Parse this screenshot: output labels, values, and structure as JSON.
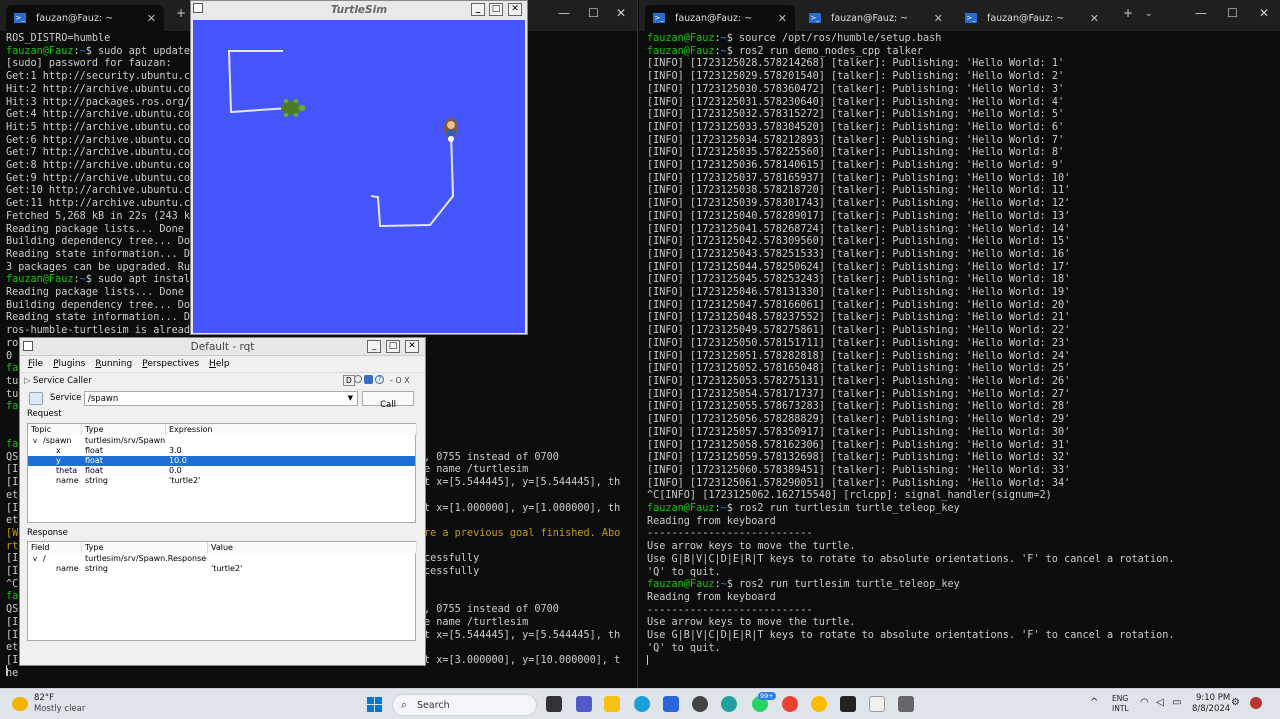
{
  "left_terminal": {
    "tab_label": "fauzan@Fauz: ~",
    "lines_top": [
      {
        "t": "ROS_DISTRO=humble"
      },
      {
        "p": "fauzan@Fauz",
        "c": "~",
        "cmd": "$ sudo apt update"
      },
      {
        "t": "[sudo] password for fauzan:"
      },
      {
        "t": "Get:1 http://security.ubuntu.co"
      },
      {
        "t": "Hit:2 http://archive.ubuntu.com"
      },
      {
        "t": "Hit:3 http://packages.ros.org/r"
      },
      {
        "t": "Get:4 http://archive.ubuntu.com"
      },
      {
        "t": "Hit:5 http://archive.ubuntu.com"
      },
      {
        "t": "Get:6 http://archive.ubuntu.com"
      },
      {
        "t": "Get:7 http://archive.ubuntu.com"
      },
      {
        "t": "Get:8 http://archive.ubuntu.com                                             ]"
      },
      {
        "t": "Get:9 http://archive.ubuntu.com                                             B]"
      },
      {
        "t": "Get:10 http://archive.ubuntu.co                                             ]"
      },
      {
        "t": "Get:11 http://archive.ubuntu.co                                           .9 kB]"
      },
      {
        "t": "Fetched 5,268 kB in 22s (243 k"
      },
      {
        "t": "Reading package lists... Done"
      },
      {
        "t": "Building dependency tree... Don"
      },
      {
        "t": "Reading state information... Do"
      },
      {
        "t": "3 packages can be upgraded. Run"
      },
      {
        "p": "fauzan@Fauz",
        "c": "~",
        "cmd": "$ sudo apt instal"
      },
      {
        "t": "Reading package lists... Done"
      },
      {
        "t": "Building dependency tree... Don"
      },
      {
        "t": "Reading state information... Do"
      },
      {
        "t": "ros-humble-turtlesim is already"
      },
      {
        "t": "ro"
      },
      {
        "t": "0"
      },
      {
        "t": "fa",
        "g": true
      },
      {
        "t": "tu"
      },
      {
        "t": "tu"
      },
      {
        "t": "fa",
        "g": true
      }
    ],
    "lines_bottom": [
      {
        "t": "fa",
        "tail": ""
      },
      {
        "t": "QS",
        "tail": ", 0755 instead of 0700"
      },
      {
        "t": "[I",
        "tail": "e name /turtlesim"
      },
      {
        "t": "[I",
        "tail": "t x=[5.544445], y=[5.544445], th"
      },
      {
        "t": "et",
        "tail": ""
      },
      {
        "t": "[I",
        "tail": "t x=[1.000000], y=[1.000000], th"
      },
      {
        "t": "et",
        "tail": ""
      },
      {
        "t": "[W",
        "tail": "re a previous goal finished. Abo",
        "warn": true
      },
      {
        "t": "rt",
        "tail": "",
        "warn": true
      },
      {
        "t": "[I",
        "tail": "cessfully"
      },
      {
        "t": "[I",
        "tail": "cessfully"
      },
      {
        "t": "^C",
        "tail": ""
      },
      {
        "t": "fa",
        "tail": ""
      },
      {
        "t": "QS",
        "tail": ", 0755 instead of 0700"
      },
      {
        "t": "[I",
        "tail": "e name /turtlesim"
      },
      {
        "t": "[I",
        "tail": "t x=[5.544445], y=[5.544445], th"
      },
      {
        "t": "et",
        "tail": ""
      },
      {
        "t": "[I",
        "tail": "t x=[3.000000], y=[10.000000], t"
      },
      {
        "t": "he",
        "tail": ""
      }
    ]
  },
  "right_terminal": {
    "tabs": [
      "fauzan@Fauz: ~",
      "fauzan@Fauz: ~",
      "fauzan@Fauz: ~"
    ],
    "prompt_user": "fauzan@Fauz",
    "prompt_dir": "~",
    "cmd1": "$ source /opt/ros/humble/setup.bash",
    "cmd2": "$ ros2 run demo_nodes_cpp talker",
    "info_prefix": "[INFO] [",
    "talker_mid": "] [talker]: Publishing: 'Hello World: ",
    "talker_stamps": [
      "1723125028.578214268",
      "1723125029.578201540",
      "1723125030.578360472",
      "1723125031.578230640",
      "1723125032.578315272",
      "1723125033.578304520",
      "1723125034.578212893",
      "1723125035.578225560",
      "1723125036.578140615",
      "1723125037.578165937",
      "1723125038.578218720",
      "1723125039.578301743",
      "1723125040.578289017",
      "1723125041.578268724",
      "1723125042.578309560",
      "1723125043.578251533",
      "1723125044.578250624",
      "1723125045.578253243",
      "1723125046.578131330",
      "1723125047.578166061",
      "1723125048.578237552",
      "1723125049.578275861",
      "1723125050.578151711",
      "1723125051.578282818",
      "1723125052.578165048",
      "1723125053.578275131",
      "1723125054.578171737",
      "1723125055.578673283",
      "1723125056.578288829",
      "1723125057.578350917",
      "1723125058.578162306",
      "1723125059.578132698",
      "1723125060.578389451",
      "1723125061.578290051"
    ],
    "signal_line": "^C[INFO] [1723125062.162715540] [rclcpp]: signal_handler(signum=2)",
    "cmd3": "$ ros2 run turtlesim turtle_teleop_key",
    "teleop": [
      "Reading from keyboard",
      "---------------------------",
      "Use arrow keys to move the turtle.",
      "Use G|B|V|C|D|E|R|T keys to rotate to absolute orientations. 'F' to cancel a rotation.",
      "'Q' to quit."
    ]
  },
  "turtlesim": {
    "title": "TurtleSim",
    "bg_color": "#4556ff",
    "btn_min": "_",
    "btn_max": "□",
    "btn_close": "✕"
  },
  "rqt": {
    "title": "Default - rqt",
    "menu": [
      "File",
      "Plugins",
      "Running",
      "Perspectives",
      "Help"
    ],
    "plugin_title": "Service Caller",
    "plugin_tools": "D",
    "plugin_tools_right": "- O X",
    "service_label": "Service",
    "service_value": "/spawn",
    "call_label": "Call",
    "request_label": "Request",
    "req_headers": [
      "Topic",
      "Type",
      "Expression"
    ],
    "req_rows": [
      {
        "topic": "/spawn",
        "type": "turtlesim/srv/Spawn",
        "expr": "",
        "indent": 0,
        "arrow": "v"
      },
      {
        "topic": "x",
        "type": "float",
        "expr": "3.0",
        "indent": 1
      },
      {
        "topic": "y",
        "type": "float",
        "expr": "10.0",
        "indent": 1,
        "sel": true
      },
      {
        "topic": "theta",
        "type": "float",
        "expr": "0.0",
        "indent": 1
      },
      {
        "topic": "name",
        "type": "string",
        "expr": "'turtle2'",
        "indent": 1
      }
    ],
    "response_label": "Response",
    "resp_headers": [
      "Field",
      "Type",
      "Value"
    ],
    "resp_rows": [
      {
        "topic": "/",
        "type": "turtlesim/srv/Spawn.Response",
        "expr": "",
        "indent": 0,
        "arrow": "v"
      },
      {
        "topic": "name",
        "type": "string",
        "expr": "'turtle2'",
        "indent": 1
      }
    ]
  },
  "taskbar": {
    "weather_temp": "82°F",
    "weather_desc": "Mostly clear",
    "search_placeholder": "Search",
    "lang": "ENG",
    "lang2": "INTL",
    "time": "9:10 PM",
    "date": "8/8/2024",
    "badge": "99+"
  }
}
